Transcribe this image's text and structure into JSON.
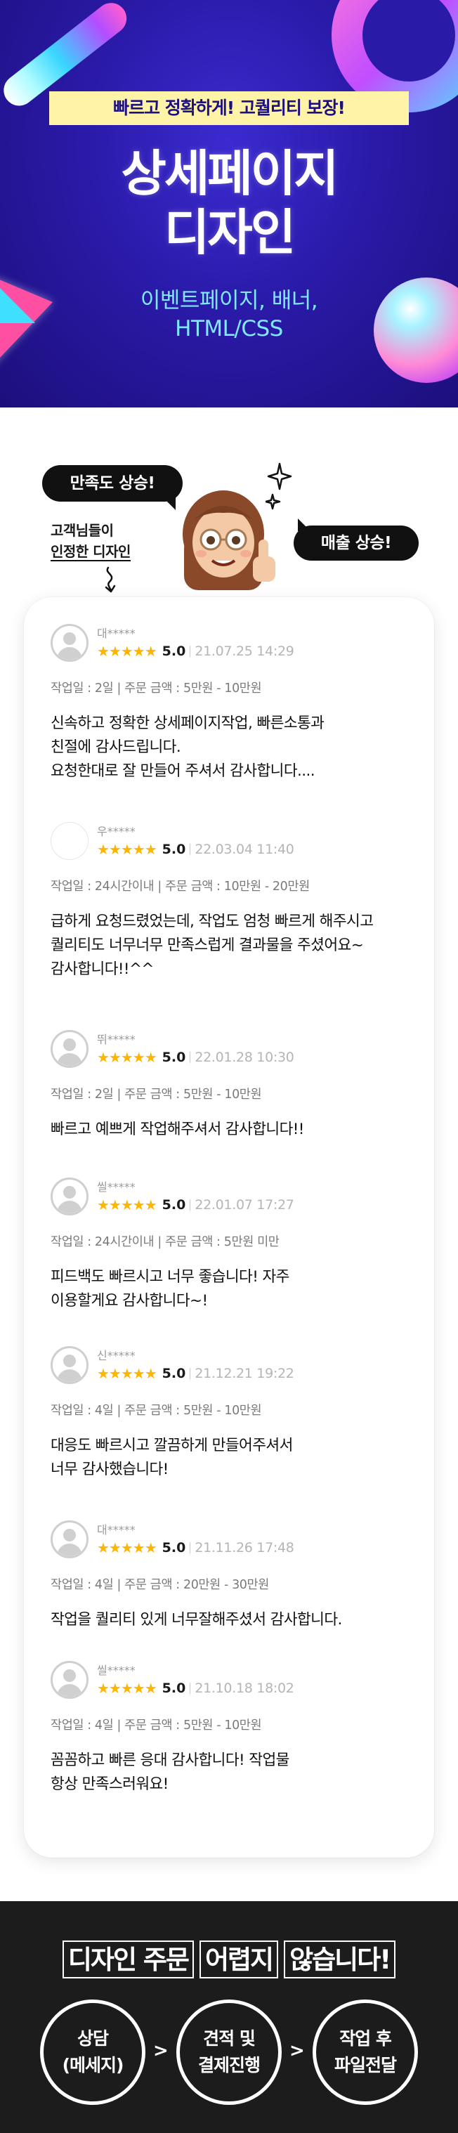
{
  "hero": {
    "tagline": "빠르고 정확하게! 고퀄리티 보장!",
    "title_line1": "상세페이지",
    "title_line2": "디자인",
    "subtitle_line1": "이벤트페이지, 배너,",
    "subtitle_line2": "HTML/CSS",
    "colors": {
      "background": "#2a1aa8",
      "tagline_bg": "#fff3a8",
      "subtitle": "#7fe8ff"
    }
  },
  "intro": {
    "bubble_satisfaction": "만족도 상승!",
    "bubble_sales": "매출 상승!",
    "caption_line1": "고객님들이",
    "caption_line2": "인정한 디자인"
  },
  "reviews": [
    {
      "name": "대*****",
      "stars": "★★★★★",
      "score": "5.0",
      "date": "21.07.25 14:29",
      "meta": "작업일 : 2일 | 주문 금액 : 5만원 - 10만원",
      "text": "신속하고 정확한 상세페이지작업, 빠른소통과\n친절에 감사드립니다.\n요청한대로 잘 만들어 주셔서 감사합니다...."
    },
    {
      "name": "우*****",
      "stars": "★★★★★",
      "score": "5.0",
      "date": "22.03.04 11:40",
      "meta": "작업일 : 24시간이내 | 주문 금액 : 10만원 - 20만원",
      "text": "급하게 요청드렸었는데, 작업도 엄청 빠르게 해주시고\n퀄리티도 너무너무 만족스럽게 결과물을 주셨어요~\n감사합니다!!^^"
    },
    {
      "name": "뛰*****",
      "stars": "★★★★★",
      "score": "5.0",
      "date": "22.01.28 10:30",
      "meta": "작업일 : 2일 | 주문 금액 : 5만원 - 10만원",
      "text": "빠르고 예쁘게 작업해주셔서 감사합니다!!"
    },
    {
      "name": "씰*****",
      "stars": "★★★★★",
      "score": "5.0",
      "date": "22.01.07 17:27",
      "meta": "작업일 : 24시간이내 | 주문 금액 : 5만원 미만",
      "text": "피드백도 빠르시고 너무 좋습니다! 자주\n이용할게요 감사합니다~!"
    },
    {
      "name": "신*****",
      "stars": "★★★★★",
      "score": "5.0",
      "date": "21.12.21 19:22",
      "meta": "작업일 : 4일 | 주문 금액 : 5만원 - 10만원",
      "text": "대응도 빠르시고 깔끔하게 만들어주셔서\n너무 감사했습니다!"
    },
    {
      "name": "대*****",
      "stars": "★★★★★",
      "score": "5.0",
      "date": "21.11.26 17:48",
      "meta": "작업일 : 4일 | 주문 금액 : 20만원 - 30만원",
      "text": "작업을 퀄리티 있게 너무잘해주셨서 감사합니다."
    },
    {
      "name": "씰*****",
      "stars": "★★★★★",
      "score": "5.0",
      "date": "21.10.18 18:02",
      "meta": "작업일 : 4일 | 주문 금액 : 5만원 - 10만원",
      "text": "꼼꼼하고 빠른 응대 감사합니다! 작업물\n항상 만족스러워요!"
    }
  ],
  "process": {
    "heading_words": [
      "디자인 주문",
      "어렵지",
      "않습니다!"
    ],
    "steps": [
      {
        "line1": "상담",
        "line2": "(메세지)"
      },
      {
        "line1": "견적 및",
        "line2": "결제진행"
      },
      {
        "line1": "작업 후",
        "line2": "파일전달"
      }
    ],
    "chevron": ">"
  }
}
